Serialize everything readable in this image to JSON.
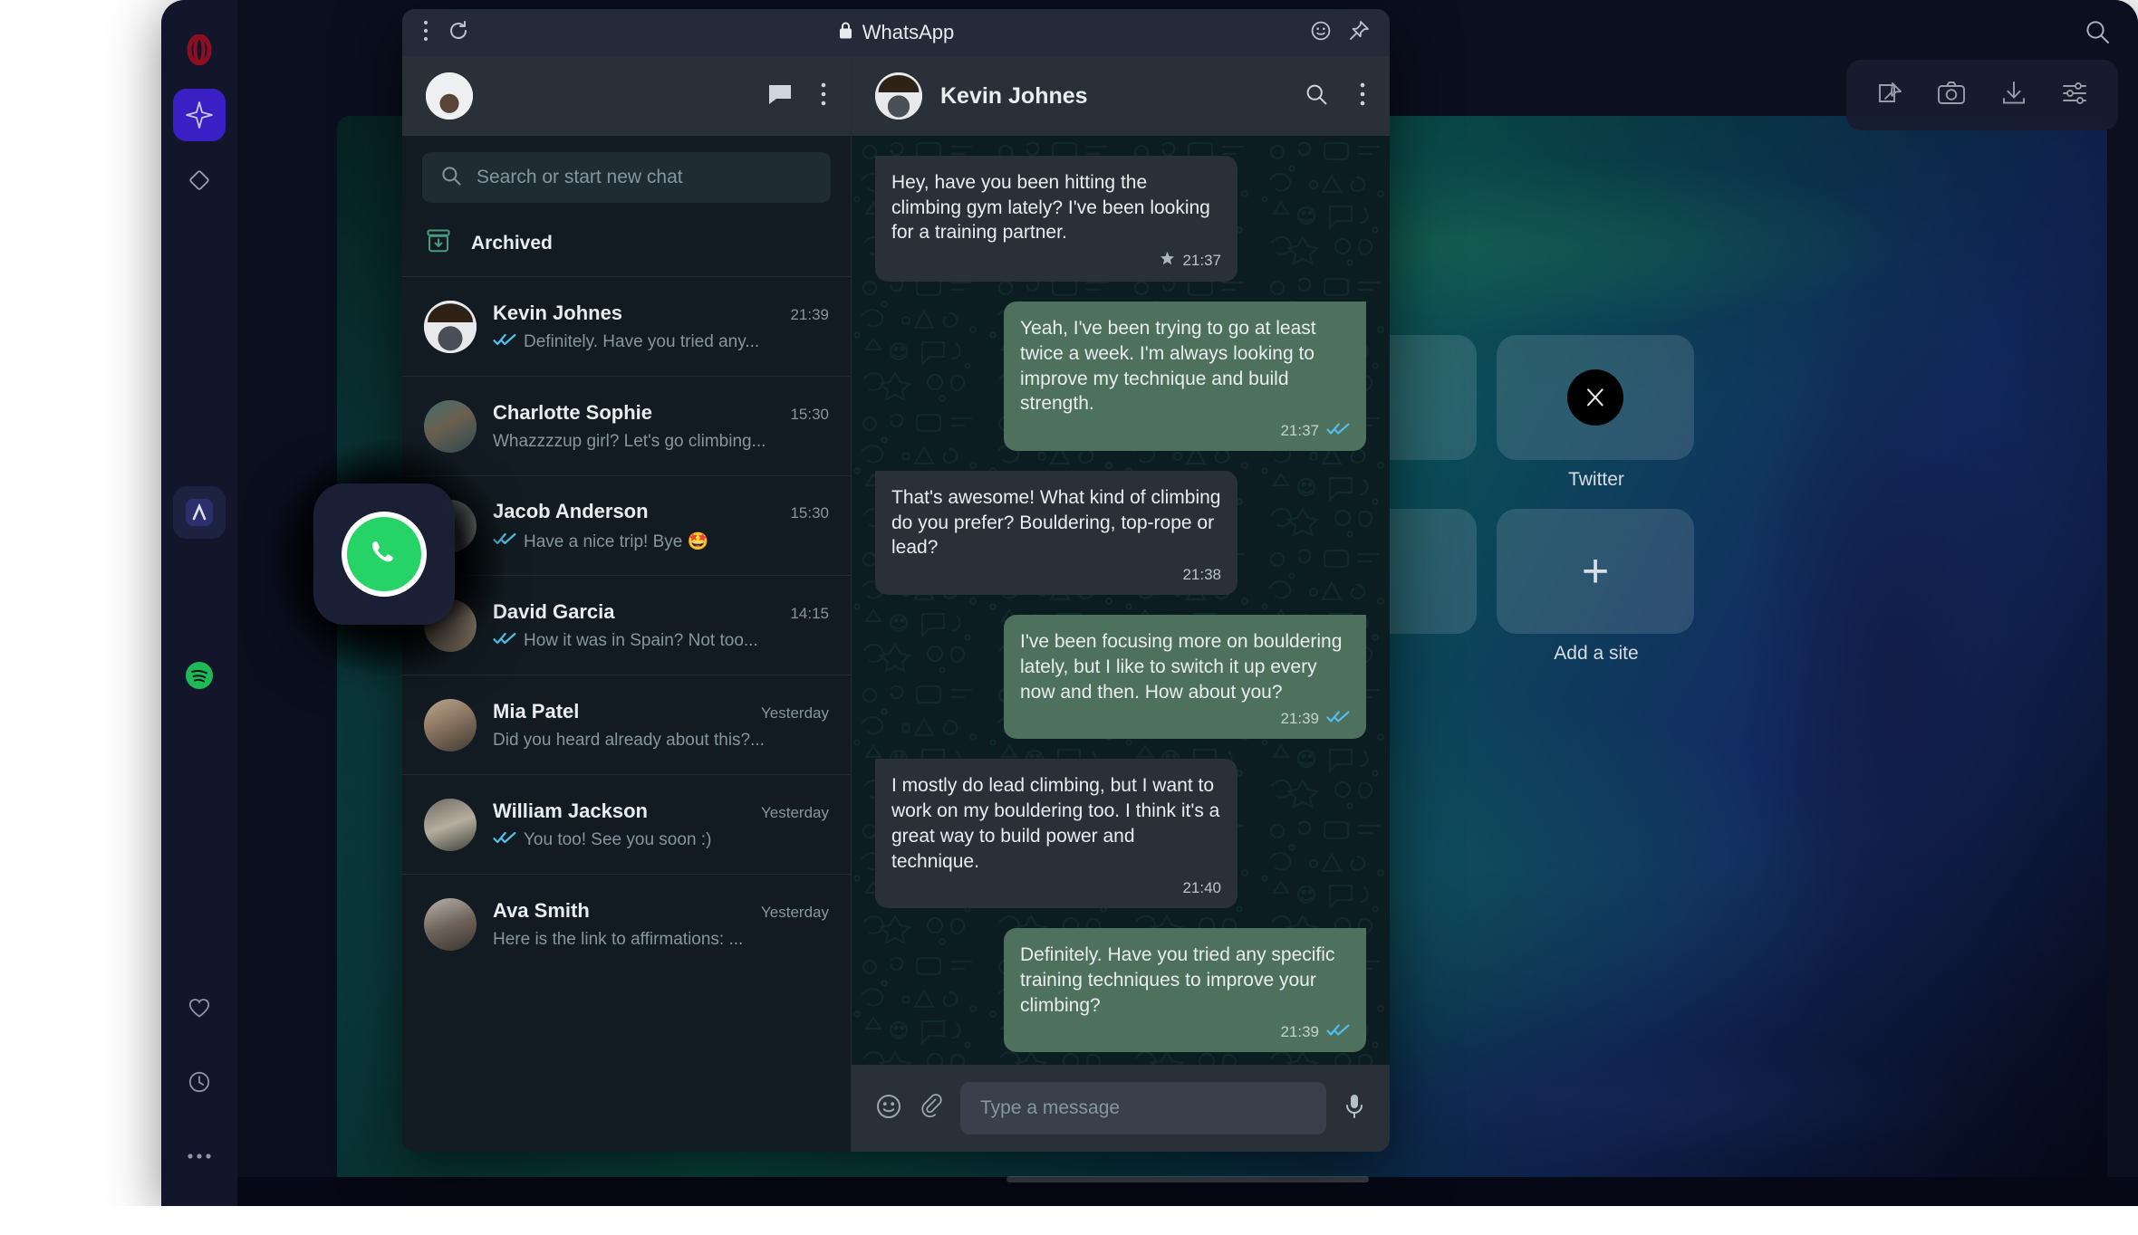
{
  "browser": {
    "name": "Opera",
    "rail": {
      "top_items": [
        {
          "name": "opera-logo",
          "icon": "opera-logo-icon"
        },
        {
          "name": "aria-ai",
          "icon": "sparkle-icon",
          "active": true
        },
        {
          "name": "pinboard",
          "icon": "diamond-icon",
          "active": false
        }
      ],
      "app_items": [
        {
          "name": "app-unknown",
          "icon": "app-tile-icon"
        },
        {
          "name": "whatsapp",
          "icon": "whatsapp-icon"
        },
        {
          "name": "spotify",
          "icon": "spotify-icon"
        }
      ],
      "bottom_items": [
        {
          "name": "favorites",
          "icon": "heart-icon"
        },
        {
          "name": "history",
          "icon": "clock-icon"
        },
        {
          "name": "more",
          "icon": "ellipsis-icon"
        }
      ]
    },
    "topbar": {
      "search_icon": "search-icon"
    },
    "toolbar": {
      "items": [
        {
          "name": "pin-to-board",
          "icon": "pin-board-icon"
        },
        {
          "name": "capture-screenshot",
          "icon": "camera-icon"
        },
        {
          "name": "downloads",
          "icon": "download-icon"
        },
        {
          "name": "easy-setup",
          "icon": "sliders-icon"
        }
      ]
    },
    "speed_dial": {
      "search_icon": "search-icon",
      "tiles": [
        {
          "label": "Twitter",
          "icon": "x-logo-icon"
        },
        {
          "label": "Add a site",
          "icon": "plus-icon"
        }
      ]
    }
  },
  "whatsapp": {
    "titlebar": {
      "menu_icon": "kebab-menu-icon",
      "reload_icon": "reload-icon",
      "lock_icon": "lock-icon",
      "title": "WhatsApp",
      "emoji_icon": "smiley-icon",
      "pin_icon": "pin-icon"
    },
    "left_panel": {
      "profile_avatar": "user-avatar",
      "new_chat_icon": "new-chat-icon",
      "menu_icon": "kebab-menu-icon",
      "search": {
        "icon": "search-icon",
        "placeholder": "Search or start new chat",
        "value": ""
      },
      "archived": {
        "label": "Archived",
        "icon": "archive-icon"
      },
      "chats": [
        {
          "name": "Kevin Johnes",
          "time": "21:39",
          "snippet": "Definitely. Have you tried any...",
          "ticks": "read",
          "avatar": "ph-kevin",
          "active": true
        },
        {
          "name": "Charlotte Sophie",
          "time": "15:30",
          "snippet": "Whazzzzup girl? Let's go climbing...",
          "ticks": "none",
          "avatar": "ph-charlotte",
          "active": false
        },
        {
          "name": "Jacob Anderson",
          "time": "15:30",
          "snippet": "Have a nice trip! Bye 🤩",
          "ticks": "read",
          "avatar": "ph-jacob",
          "active": false
        },
        {
          "name": "David Garcia",
          "time": "14:15",
          "snippet": "How it was in Spain? Not too...",
          "ticks": "read",
          "avatar": "ph-david",
          "active": false
        },
        {
          "name": "Mia Patel",
          "time": "Yesterday",
          "snippet": "Did you heard already about this?...",
          "ticks": "none",
          "avatar": "ph-mia",
          "active": false
        },
        {
          "name": "William Jackson",
          "time": "Yesterday",
          "snippet": "You too! See you soon :)",
          "ticks": "read",
          "avatar": "ph-will",
          "active": false
        },
        {
          "name": "Ava Smith",
          "time": "Yesterday",
          "snippet": "Here is the link to affirmations: ...",
          "ticks": "none",
          "avatar": "ph-ava",
          "active": false
        }
      ]
    },
    "conversation": {
      "contact_name": "Kevin Johnes",
      "contact_avatar": "ph-kevin",
      "search_icon": "search-icon",
      "menu_icon": "kebab-menu-icon",
      "messages": [
        {
          "direction": "in",
          "text": "Hey, have you been hitting the climbing gym lately? I've been looking for a training partner.",
          "time": "21:37",
          "starred": true,
          "ticks": "none"
        },
        {
          "direction": "out",
          "text": "Yeah, I've been trying to go at least twice a week. I'm always looking to improve my technique and build strength.",
          "time": "21:37",
          "starred": false,
          "ticks": "read"
        },
        {
          "direction": "in",
          "text": "That's awesome! What kind of climbing do you prefer? Bouldering, top-rope or lead?",
          "time": "21:38",
          "starred": false,
          "ticks": "none"
        },
        {
          "direction": "out",
          "text": "I've been focusing more on bouldering lately, but I like to switch it up every now and then. How about you?",
          "time": "21:39",
          "starred": false,
          "ticks": "read"
        },
        {
          "direction": "in",
          "text": "I mostly do lead climbing, but I want to work on my bouldering too. I think it's a great way to build power and technique.",
          "time": "21:40",
          "starred": false,
          "ticks": "none"
        },
        {
          "direction": "out",
          "text": "Definitely. Have you tried any specific training techniques to improve your climbing?",
          "time": "21:39",
          "starred": false,
          "ticks": "read"
        }
      ],
      "composer": {
        "emoji_icon": "smiley-icon",
        "attach_icon": "paperclip-icon",
        "placeholder": "Type a message",
        "value": "",
        "mic_icon": "microphone-icon"
      }
    }
  }
}
